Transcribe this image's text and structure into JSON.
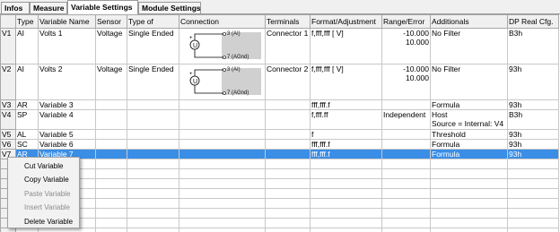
{
  "tabs": [
    {
      "label": "Infos",
      "active": false
    },
    {
      "label": "Measure",
      "active": false
    },
    {
      "label": "Variable Settings",
      "active": true
    },
    {
      "label": "Module Settings",
      "active": false
    }
  ],
  "columns": [
    "Type",
    "Variable Name",
    "Sensor",
    "Type of",
    "Connection",
    "Terminals",
    "Format/Adjustment",
    "Range/Error",
    "Additionals",
    "DP Real Cfg."
  ],
  "rows": [
    {
      "id": "V1",
      "type": "AI",
      "name": "Volts 1",
      "sensor": "Voltage",
      "typeof": "Single Ended",
      "terminals": "Connector 1",
      "format": "f,fff,fff [ V]",
      "range1": "-10.000",
      "range2": "10.000",
      "additionals": "No Filter",
      "additionals2": "",
      "dp": "B3h",
      "conn": {
        "top": "3 (AI)",
        "bottom": "7 (AGnd)"
      }
    },
    {
      "id": "V2",
      "type": "AI",
      "name": "Volts 2",
      "sensor": "Voltage",
      "typeof": "Single Ended",
      "terminals": "Connector 2",
      "format": "f,fff,fff [ V]",
      "range1": "-10.000",
      "range2": "10.000",
      "additionals": "No Filter",
      "additionals2": "",
      "dp": "93h",
      "conn": {
        "top": "3 (AI)",
        "bottom": "7 (AGnd)"
      }
    },
    {
      "id": "V3",
      "type": "AR",
      "name": "Variable 3",
      "sensor": "",
      "typeof": "",
      "terminals": "",
      "format": "fff,fff.f",
      "range1": "",
      "range2": "",
      "additionals": "Formula",
      "additionals2": "",
      "dp": "93h"
    },
    {
      "id": "V4",
      "type": "SP",
      "name": "Variable 4",
      "sensor": "",
      "typeof": "",
      "terminals": "",
      "format": "f,fff.ff",
      "range1": "Independent",
      "range2": "",
      "additionals": "Host",
      "additionals2": "Source = Internal: V4",
      "dp": "B3h"
    },
    {
      "id": "V5",
      "type": "AL",
      "name": "Variable 5",
      "sensor": "",
      "typeof": "",
      "terminals": "",
      "format": "f",
      "range1": "",
      "range2": "",
      "additionals": "Threshold",
      "additionals2": "",
      "dp": "93h"
    },
    {
      "id": "V6",
      "type": "SC",
      "name": "Variable 6",
      "sensor": "",
      "typeof": "",
      "terminals": "",
      "format": "fff,fff.f",
      "range1": "",
      "range2": "",
      "additionals": "Formula",
      "additionals2": "",
      "dp": "93h"
    },
    {
      "id": "V7",
      "type": "AR",
      "name": "Variable 7",
      "sensor": "",
      "typeof": "",
      "terminals": "",
      "format": "fff,fff.f",
      "range1": "",
      "range2": "",
      "additionals": "Formula",
      "additionals2": "",
      "dp": "93h",
      "selected": true
    }
  ],
  "context_menu": [
    {
      "label": "Cut Variable",
      "enabled": true
    },
    {
      "label": "Copy Variable",
      "enabled": true
    },
    {
      "label": "Paste Variable",
      "enabled": false
    },
    {
      "label": "Insert Variable",
      "enabled": false
    },
    {
      "label": "Delete Variable",
      "enabled": true
    }
  ],
  "colors": {
    "selection": "#3a8ee6",
    "header_bg": "#f0f0f0",
    "grid_line": "#c8c8c8"
  },
  "icons": {
    "connection": "voltage-source-connection-diagram-icon"
  }
}
